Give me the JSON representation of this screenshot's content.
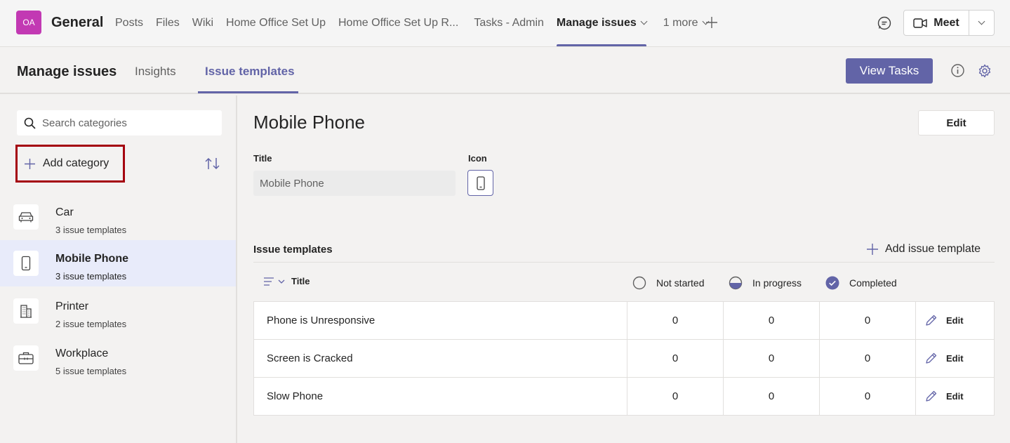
{
  "top": {
    "avatar": "OA",
    "channel": "General",
    "tabs": [
      {
        "label": "Posts"
      },
      {
        "label": "Files"
      },
      {
        "label": "Wiki"
      },
      {
        "label": "Home Office Set Up"
      },
      {
        "label": "Home Office Set Up R..."
      },
      {
        "label": "Tasks - Admin"
      },
      {
        "label": "Manage issues"
      },
      {
        "label": "1 more"
      }
    ],
    "meet_label": "Meet"
  },
  "app": {
    "title": "Manage issues",
    "tabs": [
      {
        "label": "Insights"
      },
      {
        "label": "Issue templates"
      }
    ],
    "view_tasks_label": "View Tasks"
  },
  "left": {
    "search_placeholder": "Search categories",
    "add_category_label": "Add category",
    "categories": [
      {
        "name": "Car",
        "count": "3 issue templates",
        "icon": "car-icon"
      },
      {
        "name": "Mobile Phone",
        "count": "3 issue templates",
        "icon": "mobile-phone-icon"
      },
      {
        "name": "Printer",
        "count": "2 issue templates",
        "icon": "building-icon"
      },
      {
        "name": "Workplace",
        "count": "5 issue templates",
        "icon": "briefcase-icon"
      }
    ]
  },
  "detail": {
    "title": "Mobile Phone",
    "edit_label": "Edit",
    "title_label": "Title",
    "title_value": "Mobile Phone",
    "icon_label": "Icon",
    "templates_heading": "Issue templates",
    "add_template_label": "Add issue template",
    "columns": {
      "title": "Title",
      "not_started": "Not started",
      "in_progress": "In progress",
      "completed": "Completed"
    },
    "rows": [
      {
        "title": "Phone is Unresponsive",
        "not_started": "0",
        "in_progress": "0",
        "completed": "0",
        "edit": "Edit"
      },
      {
        "title": "Screen is Cracked",
        "not_started": "0",
        "in_progress": "0",
        "completed": "0",
        "edit": "Edit"
      },
      {
        "title": "Slow Phone",
        "not_started": "0",
        "in_progress": "0",
        "completed": "0",
        "edit": "Edit"
      }
    ]
  },
  "colors": {
    "accent": "#6264a7",
    "avatar": "#c239b3",
    "highlight_border": "#a4000f",
    "selected_bg": "#e8ebfa"
  }
}
